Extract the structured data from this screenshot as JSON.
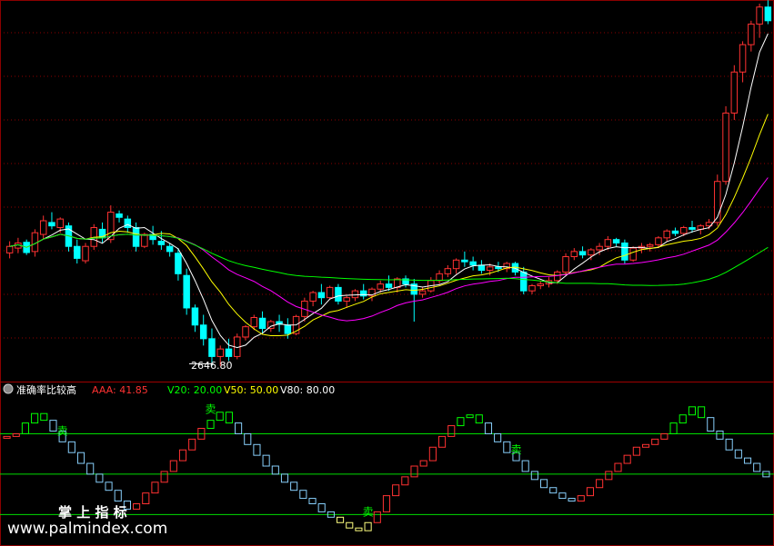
{
  "indicator": {
    "name": "准确率比较高",
    "aaa": "AAA: 41.85",
    "v20": "V20: 20.00",
    "v50": "V50: 50.00",
    "v80": "V80: 80.00"
  },
  "price_annotation": "2646.80",
  "watermark": {
    "cn": "掌 上 指 标",
    "url": "www.palmindex.com"
  },
  "signal_labels": {
    "sell": "卖",
    "buy": "买"
  },
  "colors": {
    "up": "#ff3232",
    "down": "#00ffff",
    "ma5": "#ffffff",
    "ma10": "#ffff00",
    "ma20": "#ff00ff",
    "ma60": "#00ff00",
    "grid": "#8b0000",
    "osc_up": "#ff3232",
    "osc_down": "#87cefa",
    "osc_top": "#00ff00",
    "osc_bottom": "#ffff80",
    "level": "#00dd00"
  },
  "chart_data": [
    {
      "type": "candlestick",
      "ylim": [
        2600,
        3700
      ],
      "y_axis": "price",
      "candles": [
        [
          2971,
          3005,
          2955,
          2990
        ],
        [
          2985,
          3015,
          2970,
          3000
        ],
        [
          3002,
          3010,
          2965,
          2972
        ],
        [
          2975,
          3040,
          2960,
          3030
        ],
        [
          3025,
          3080,
          3010,
          3065
        ],
        [
          3060,
          3090,
          3040,
          3050
        ],
        [
          3045,
          3075,
          3030,
          3070
        ],
        [
          3050,
          3060,
          2975,
          2990
        ],
        [
          2990,
          3010,
          2940,
          2955
        ],
        [
          2948,
          3000,
          2940,
          2990
        ],
        [
          2990,
          3055,
          2980,
          3045
        ],
        [
          3040,
          3060,
          3000,
          3015
        ],
        [
          3010,
          3110,
          3000,
          3090
        ],
        [
          3085,
          3095,
          3060,
          3075
        ],
        [
          3070,
          3080,
          3030,
          3045
        ],
        [
          3045,
          3060,
          2975,
          2990
        ],
        [
          2990,
          3030,
          2985,
          3025
        ],
        [
          3025,
          3050,
          2995,
          3010
        ],
        [
          3005,
          3035,
          2980,
          2995
        ],
        [
          2990,
          3000,
          2960,
          2975
        ],
        [
          2970,
          2985,
          2890,
          2910
        ],
        [
          2905,
          2925,
          2790,
          2810
        ],
        [
          2810,
          2820,
          2740,
          2760
        ],
        [
          2760,
          2790,
          2700,
          2720
        ],
        [
          2720,
          2750,
          2640,
          2668
        ],
        [
          2668,
          2700,
          2640,
          2690
        ],
        [
          2690,
          2720,
          2655,
          2668
        ],
        [
          2668,
          2735,
          2660,
          2725
        ],
        [
          2725,
          2760,
          2715,
          2755
        ],
        [
          2755,
          2790,
          2745,
          2782
        ],
        [
          2780,
          2800,
          2735,
          2750
        ],
        [
          2750,
          2775,
          2740,
          2770
        ],
        [
          2770,
          2790,
          2740,
          2762
        ],
        [
          2760,
          2780,
          2720,
          2735
        ],
        [
          2735,
          2790,
          2730,
          2785
        ],
        [
          2785,
          2840,
          2770,
          2830
        ],
        [
          2830,
          2860,
          2815,
          2855
        ],
        [
          2855,
          2880,
          2820,
          2840
        ],
        [
          2840,
          2875,
          2835,
          2870
        ],
        [
          2870,
          2880,
          2820,
          2830
        ],
        [
          2830,
          2845,
          2810,
          2840
        ],
        [
          2840,
          2865,
          2830,
          2860
        ],
        [
          2860,
          2880,
          2835,
          2845
        ],
        [
          2845,
          2870,
          2830,
          2865
        ],
        [
          2865,
          2890,
          2855,
          2880
        ],
        [
          2880,
          2905,
          2860,
          2870
        ],
        [
          2870,
          2900,
          2855,
          2895
        ],
        [
          2895,
          2905,
          2870,
          2880
        ],
        [
          2880,
          2895,
          2770,
          2850
        ],
        [
          2850,
          2870,
          2840,
          2860
        ],
        [
          2860,
          2900,
          2855,
          2890
        ],
        [
          2890,
          2920,
          2880,
          2910
        ],
        [
          2910,
          2935,
          2900,
          2925
        ],
        [
          2925,
          2955,
          2910,
          2950
        ],
        [
          2950,
          2975,
          2930,
          2945
        ],
        [
          2945,
          2960,
          2920,
          2935
        ],
        [
          2935,
          2950,
          2910,
          2920
        ],
        [
          2920,
          2940,
          2905,
          2930
        ],
        [
          2930,
          2945,
          2915,
          2925
        ],
        [
          2925,
          2945,
          2915,
          2940
        ],
        [
          2940,
          2945,
          2905,
          2915
        ],
        [
          2915,
          2930,
          2850,
          2860
        ],
        [
          2860,
          2880,
          2850,
          2875
        ],
        [
          2875,
          2890,
          2865,
          2880
        ],
        [
          2880,
          2900,
          2870,
          2890
        ],
        [
          2890,
          2920,
          2880,
          2915
        ],
        [
          2915,
          2970,
          2905,
          2960
        ],
        [
          2960,
          2985,
          2950,
          2975
        ],
        [
          2975,
          2990,
          2955,
          2965
        ],
        [
          2965,
          2985,
          2950,
          2980
        ],
        [
          2980,
          3000,
          2965,
          2990
        ],
        [
          2990,
          3020,
          2980,
          3010
        ],
        [
          3010,
          3015,
          2990,
          3000
        ],
        [
          3000,
          3010,
          2940,
          2950
        ],
        [
          2950,
          2990,
          2945,
          2985
        ],
        [
          2985,
          3000,
          2970,
          2990
        ],
        [
          2990,
          3000,
          2975,
          2995
        ],
        [
          2995,
          3020,
          2985,
          3015
        ],
        [
          3015,
          3040,
          3005,
          3035
        ],
        [
          3035,
          3045,
          3020,
          3028
        ],
        [
          3028,
          3050,
          3020,
          3045
        ],
        [
          3045,
          3065,
          3030,
          3040
        ],
        [
          3040,
          3055,
          3025,
          3050
        ],
        [
          3050,
          3070,
          3040,
          3060
        ],
        [
          3060,
          3200,
          3050,
          3180
        ],
        [
          3180,
          3400,
          3170,
          3380
        ],
        [
          3380,
          3520,
          3360,
          3500
        ],
        [
          3500,
          3590,
          3470,
          3580
        ],
        [
          3580,
          3650,
          3560,
          3640
        ],
        [
          3640,
          3700,
          3600,
          3690
        ],
        [
          3690,
          3710,
          3640,
          3650
        ]
      ],
      "ma_lines": [
        "MA5",
        "MA10",
        "MA20",
        "MA60"
      ],
      "annotation": {
        "label": "2646.80",
        "value": 2646.8
      }
    },
    {
      "type": "step_oscillator",
      "indicator": "准确率比较高",
      "ylim": [
        0,
        100
      ],
      "levels": [
        20,
        50,
        80
      ],
      "current_value": 41.85,
      "values": [
        78,
        80,
        88,
        95,
        90,
        82,
        74,
        66,
        58,
        50,
        44,
        38,
        30,
        24,
        28,
        36,
        44,
        52,
        60,
        68,
        76,
        84,
        90,
        96,
        88,
        80,
        72,
        64,
        56,
        50,
        44,
        38,
        32,
        28,
        22,
        18,
        14,
        10,
        8,
        14,
        22,
        34,
        42,
        48,
        56,
        60,
        70,
        78,
        86,
        92,
        94,
        88,
        80,
        74,
        66,
        60,
        52,
        46,
        40,
        36,
        32,
        30,
        34,
        40,
        46,
        52,
        58,
        64,
        70,
        72,
        76,
        80,
        88,
        94,
        100,
        92,
        82,
        76,
        68,
        62,
        58,
        52,
        48
      ],
      "markers": [
        {
          "x": 6,
          "type": "sell"
        },
        {
          "x": 22,
          "type": "sell"
        },
        {
          "x": 39,
          "type": "sell"
        },
        {
          "x": 55,
          "type": "sell"
        },
        {
          "x": 94,
          "type": "sell"
        },
        {
          "x": 100,
          "type": "buy"
        }
      ]
    }
  ]
}
